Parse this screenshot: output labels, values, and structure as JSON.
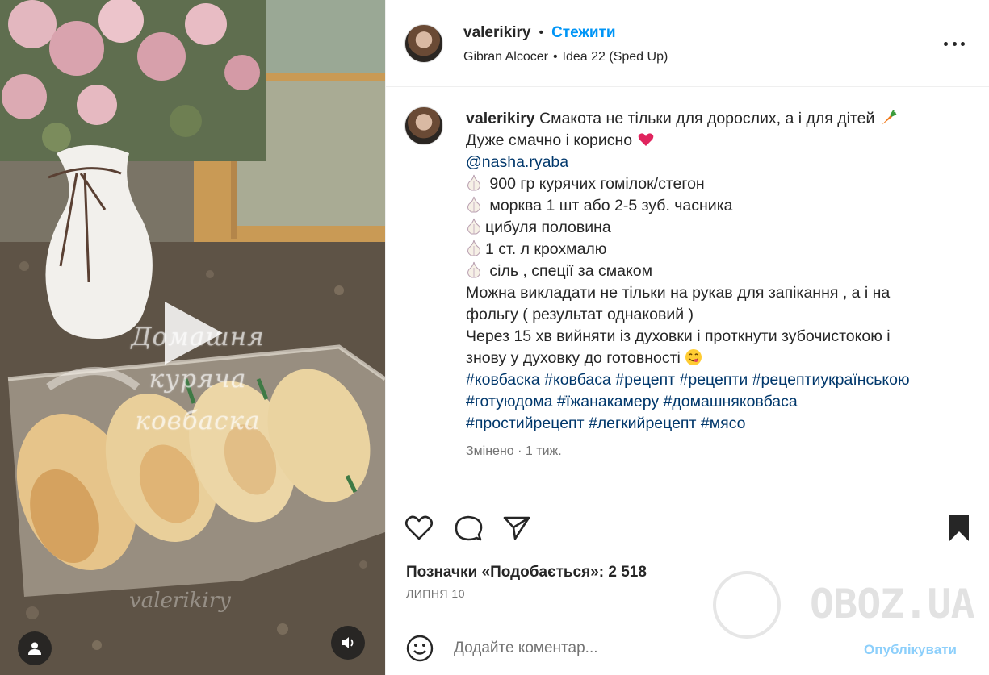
{
  "media": {
    "overlay_title_line1": "Домашня куряча",
    "overlay_title_line2": "ковбаска",
    "watermark_username": "valerikiry"
  },
  "header": {
    "username": "valerikiry",
    "separator": "•",
    "follow_label": "Стежити",
    "audio_artist": "Gibran Alcocer",
    "audio_separator": "•",
    "audio_track": "Idea 22 (Sped Up)"
  },
  "caption": {
    "username": "valerikiry",
    "line1": "Смакота не тільки для дорослих, а і для дітей",
    "line2": "Дуже смачно і корисно",
    "mention": "@nasha.ryaba",
    "ingredient1": " 900 гр курячих гомілок/стегон",
    "ingredient2": " морква 1 шт або 2-5 зуб. часника",
    "ingredient3": "цибуля половина",
    "ingredient4": "1 ст. л крохмалю",
    "ingredient5": " сіль , спеції за смаком",
    "text1a": "Можна викладати не тільки на рукав для запікання , а і на",
    "text1b": "фольгу ( результат однаковий )",
    "text2a": "Через 15 хв вийняти із духовки і проткнути зубочистокою і",
    "text2b": "знову у духовку до готовності",
    "hashtags_line1": "#ковбаска #ковбаса #рецепт #рецепти #рецептиукраїнською",
    "hashtags_line2": "#готуюдома #їжанакамеру #домашняковбаса",
    "hashtags_line3": "#простийрецепт #легкийрецепт #мясо",
    "meta": "Змінено · 1 тиж."
  },
  "actions": {
    "likes_label": "Позначки «Подобається»:",
    "likes_count": "2 518",
    "date": "ЛИПНЯ 10"
  },
  "comment": {
    "placeholder": "Додайте коментар...",
    "publish_label": "Опублікувати"
  },
  "watermark": {
    "text": "OBOZ.UA"
  },
  "icons": {
    "like": "heart-icon",
    "comment": "comment-icon",
    "share": "send-icon",
    "save": "bookmark-icon",
    "more": "more-dots-icon",
    "play": "play-icon",
    "sound": "speaker-icon",
    "tags": "user-tag-icon",
    "emoji": "emoji-smile-icon"
  },
  "colors": {
    "accent": "#0095f6",
    "link": "#00376b",
    "text": "#262626",
    "muted": "#737373"
  }
}
